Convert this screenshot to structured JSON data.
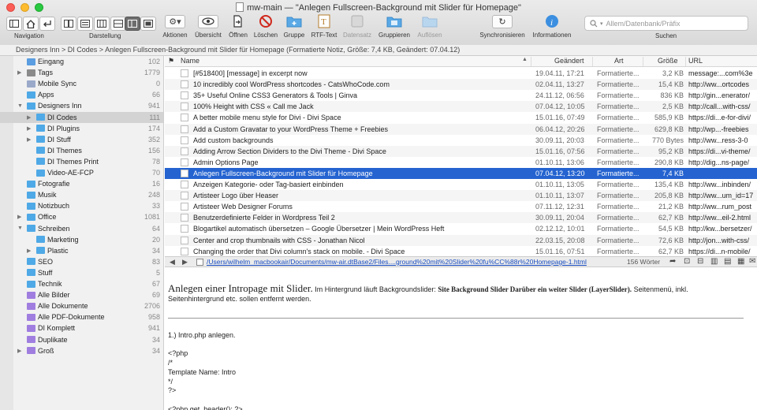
{
  "window": {
    "title": "mw-main — \"Anlegen Fullscreen-Background mit Slider für Homepage\""
  },
  "toolbar": {
    "navigation_label": "Navigation",
    "darstellung_label": "Darstellung",
    "tools": [
      {
        "label": "Aktionen",
        "icon": "gear-icon"
      },
      {
        "label": "Übersicht",
        "icon": "eye-icon"
      },
      {
        "label": "Öffnen",
        "icon": "open-icon"
      },
      {
        "label": "Löschen",
        "icon": "delete-icon"
      },
      {
        "label": "Gruppe",
        "icon": "group-icon"
      },
      {
        "label": "RTF-Text",
        "icon": "rtf-icon"
      },
      {
        "label": "Datensatz",
        "icon": "record-icon"
      },
      {
        "label": "Gruppieren",
        "icon": "grouping-icon"
      },
      {
        "label": "Auflösen",
        "icon": "ungroup-icon"
      },
      {
        "label": "Synchronisieren",
        "icon": "sync-icon"
      },
      {
        "label": "Informationen",
        "icon": "info-icon"
      }
    ],
    "search_placeholder": "Allem/Datenbank/Präfix",
    "search_label": "Suchen"
  },
  "pathbar": "Designers Inn > DI Codes > Anlegen Fullscreen-Background mit Slider für Homepage (Formatierte Notiz, Größe: 7,4 KB, Geändert: 07.04.12)",
  "sidebar": {
    "items": [
      {
        "name": "Eingang",
        "count": "102",
        "level": 0,
        "expand": "",
        "color": "#5a9de0"
      },
      {
        "name": "Tags",
        "count": "1779",
        "level": 0,
        "expand": "▶",
        "color": "#8a8a8a"
      },
      {
        "name": "Mobile Sync",
        "count": "0",
        "level": 0,
        "expand": "",
        "color": "#9aa9c9"
      },
      {
        "name": "Apps",
        "count": "66",
        "level": 0,
        "expand": "",
        "color": "#4fa9e6"
      },
      {
        "name": "Designers Inn",
        "count": "941",
        "level": 0,
        "expand": "▼",
        "color": "#4fa9e6"
      },
      {
        "name": "DI Codes",
        "count": "111",
        "level": 1,
        "expand": "▶",
        "color": "#4fa9e6",
        "selected": true
      },
      {
        "name": "DI Plugins",
        "count": "174",
        "level": 1,
        "expand": "▶",
        "color": "#4fa9e6"
      },
      {
        "name": "DI Stuff",
        "count": "352",
        "level": 1,
        "expand": "▶",
        "color": "#4fa9e6"
      },
      {
        "name": "DI Themes",
        "count": "156",
        "level": 1,
        "expand": "",
        "color": "#4fa9e6"
      },
      {
        "name": "DI Themes Print",
        "count": "78",
        "level": 1,
        "expand": "",
        "color": "#4fa9e6"
      },
      {
        "name": "Video-AE-FCP",
        "count": "70",
        "level": 1,
        "expand": "",
        "color": "#4fa9e6"
      },
      {
        "name": "Fotografie",
        "count": "16",
        "level": 0,
        "expand": "",
        "color": "#4fa9e6"
      },
      {
        "name": "Musik",
        "count": "248",
        "level": 0,
        "expand": "",
        "color": "#4fa9e6"
      },
      {
        "name": "Notizbuch",
        "count": "33",
        "level": 0,
        "expand": "",
        "color": "#4fa9e6"
      },
      {
        "name": "Office",
        "count": "1081",
        "level": 0,
        "expand": "▶",
        "color": "#4fa9e6"
      },
      {
        "name": "Schreiben",
        "count": "64",
        "level": 0,
        "expand": "▼",
        "color": "#4fa9e6"
      },
      {
        "name": "Marketing",
        "count": "20",
        "level": 1,
        "expand": "",
        "color": "#4fa9e6"
      },
      {
        "name": "Plastic",
        "count": "34",
        "level": 1,
        "expand": "▶",
        "color": "#4fa9e6"
      },
      {
        "name": "SEO",
        "count": "83",
        "level": 0,
        "expand": "",
        "color": "#4fa9e6"
      },
      {
        "name": "Stuff",
        "count": "5",
        "level": 0,
        "expand": "",
        "color": "#4fa9e6"
      },
      {
        "name": "Technik",
        "count": "67",
        "level": 0,
        "expand": "",
        "color": "#4fa9e6"
      },
      {
        "name": "Alle Bilder",
        "count": "69",
        "level": 0,
        "expand": "",
        "color": "#a07ee0"
      },
      {
        "name": "Alle Dokumente",
        "count": "2706",
        "level": 0,
        "expand": "",
        "color": "#a07ee0"
      },
      {
        "name": "Alle PDF-Dokumente",
        "count": "958",
        "level": 0,
        "expand": "",
        "color": "#a07ee0"
      },
      {
        "name": "DI Komplett",
        "count": "941",
        "level": 0,
        "expand": "",
        "color": "#a07ee0"
      },
      {
        "name": "Duplikate",
        "count": "34",
        "level": 0,
        "expand": "",
        "color": "#a07ee0"
      },
      {
        "name": "Groß",
        "count": "34",
        "level": 0,
        "expand": "▶",
        "color": "#a07ee0"
      }
    ]
  },
  "list": {
    "columns": {
      "flag": "⚑",
      "name": "Name",
      "date": "Geändert",
      "kind": "Art",
      "size": "Größe",
      "url": "URL",
      "sort": "▲"
    },
    "rows": [
      {
        "name": "[#518400] [message] in excerpt now",
        "date": "19.04.11, 17:21",
        "kind": "Formatierte...",
        "size": "3,2 KB",
        "url": "message:...com%3e"
      },
      {
        "name": "10 incredibly cool WordPress shortcodes - CatsWhoCode.com",
        "date": "02.04.11, 13:27",
        "kind": "Formatierte...",
        "size": "15,4 KB",
        "url": "http://ww...ortcodes"
      },
      {
        "name": "35+ Useful Online CSS3 Generators & Tools | Ginva",
        "date": "24.11.12, 06:56",
        "kind": "Formatierte...",
        "size": "836 KB",
        "url": "http://gin...enerator/"
      },
      {
        "name": "100% Height with CSS « Call me Jack",
        "date": "07.04.12, 10:05",
        "kind": "Formatierte...",
        "size": "2,5 KB",
        "url": "http://call...with-css/"
      },
      {
        "name": "A better mobile menu style for Divi - Divi Space",
        "date": "15.01.16, 07:49",
        "kind": "Formatierte...",
        "size": "585,9 KB",
        "url": "https://di...e-for-divi/"
      },
      {
        "name": "Add a Custom Gravatar to your WordPress Theme + Freebies",
        "date": "06.04.12, 20:26",
        "kind": "Formatierte...",
        "size": "629,8 KB",
        "url": "http://wp...-freebies"
      },
      {
        "name": "Add custom backgrounds",
        "date": "30.09.11, 20:03",
        "kind": "Formatierte...",
        "size": "770 Bytes",
        "url": "http://ww...ress-3-0"
      },
      {
        "name": "Adding Arrow Section Dividers to the Divi Theme - Divi Space",
        "date": "15.01.16, 07:56",
        "kind": "Formatierte...",
        "size": "95,2 KB",
        "url": "https://di...vi-theme/"
      },
      {
        "name": "Admin Options Page",
        "date": "01.10.11, 13:06",
        "kind": "Formatierte...",
        "size": "290,8 KB",
        "url": "http://dig...ns-page/"
      },
      {
        "name": "Anlegen Fullscreen-Background mit Slider für Homepage",
        "date": "07.04.12, 13:20",
        "kind": "Formatierte...",
        "size": "7,4 KB",
        "url": "",
        "selected": true
      },
      {
        "name": "Anzeigen Kategorie- oder Tag-basiert einbinden",
        "date": "01.10.11, 13:05",
        "kind": "Formatierte...",
        "size": "135,4 KB",
        "url": "http://ww...inbinden/"
      },
      {
        "name": "Artisteer Logo über Heaser",
        "date": "01.10.11, 13:07",
        "kind": "Formatierte...",
        "size": "205,8 KB",
        "url": "http://ww...um_id=17"
      },
      {
        "name": "Artisteer Web Designer Forums",
        "date": "07.11.12, 12:31",
        "kind": "Formatierte...",
        "size": "21,2 KB",
        "url": "http://ww...rum_post"
      },
      {
        "name": "Benutzerdefinierte Felder in Wordpress Teil 2",
        "date": "30.09.11, 20:04",
        "kind": "Formatierte...",
        "size": "62,7 KB",
        "url": "http://ww...eil-2.html"
      },
      {
        "name": "Blogartikel automatisch übersetzen – Google Übersetzer | Mein WordPress Heft",
        "date": "02.12.12, 10:01",
        "kind": "Formatierte...",
        "size": "54,5 KB",
        "url": "http://kw...bersetzer/"
      },
      {
        "name": "Center and crop thumbnails with CSS - Jonathan Nicol",
        "date": "22.03.15, 20:08",
        "kind": "Formatierte...",
        "size": "72,6 KB",
        "url": "http://jon...with-css/"
      },
      {
        "name": "Changing the order that Divi column's stack on mobile. - Divi Space",
        "date": "15.01.16, 07:51",
        "kind": "Formatierte...",
        "size": "62,7 KB",
        "url": "https://di...n-mobile/"
      }
    ]
  },
  "urlbar": {
    "url": "/Users/wilhelm_macbookair/Documents/mw-air.dtBase2/Files....ground%20mit%20Slider%20fu%CC%88r%20Homepage-1.html",
    "words": "156 Wörter"
  },
  "content": {
    "heading": "Anlegen einer Intropage mit Slider.",
    "intro": "Im Hintergrund läuft  Backgroundslider:",
    "bold": "Site Background Slider Darüber ein weiter Slider (LayerSlider).",
    "rest": "Seitenmenü, inkl. Seitenhintergrund etc. sollen entfernt werden.",
    "lines": [
      "1.) Intro.php anlegen.",
      "",
      "<?php",
      "/*",
      "Template Name: Intro",
      "*/",
      "?>",
      "",
      "<?php get_header(); ?>"
    ]
  }
}
